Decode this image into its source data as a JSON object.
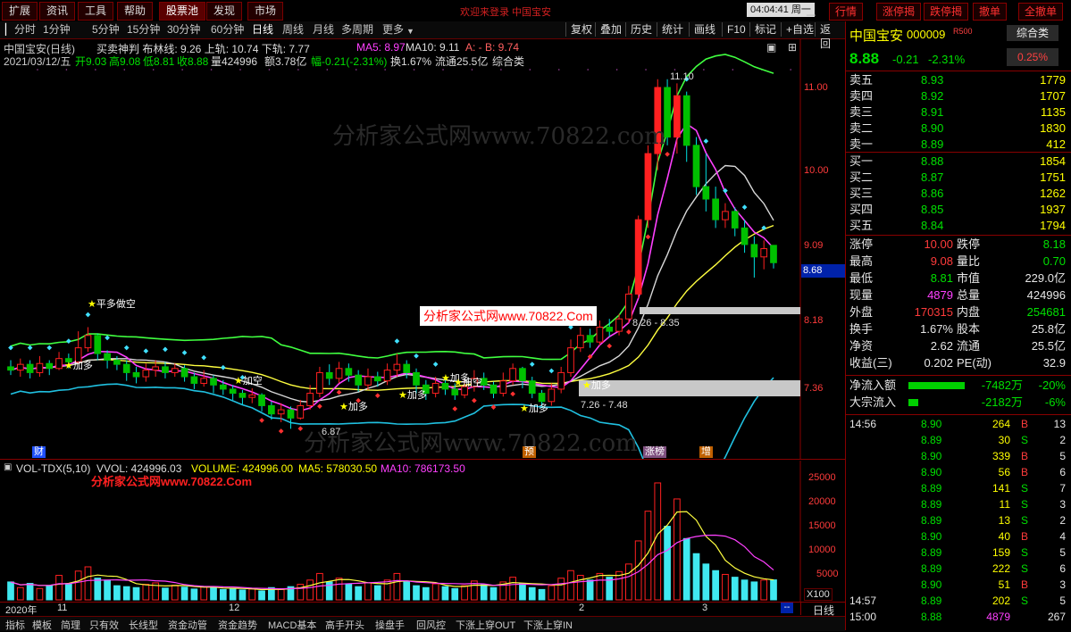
{
  "top_menu": [
    "扩展",
    "资讯",
    "工具",
    "帮助",
    "股票池",
    "发现",
    "市场"
  ],
  "top_center_text": "欢迎来登录  中国宝安",
  "clock": "04:04:41 周一",
  "right_buttons": [
    "行情",
    "涨停揭",
    "跌停揭",
    "撤单",
    "全撤单"
  ],
  "periods": [
    "分时",
    "1分钟",
    "5分钟",
    "15分钟",
    "30分钟",
    "60分钟",
    "日线",
    "周线",
    "月线",
    "多周期",
    "更多"
  ],
  "selected_period": "日线",
  "tools": [
    "复权",
    "叠加",
    "历史",
    "统计",
    "画线",
    "F10",
    "标记",
    "+自选",
    "返回"
  ],
  "info": {
    "line1_name": "中国宝安(日线)",
    "line1_rest": "买卖神判  布林线: 9.26  上轨: 10.74  下轨: 7.77",
    "ma5": "MA5: 8.97",
    "ma10": "MA10: 9.11",
    "ab": "A: -  B: 9.74",
    "line2_date": "2021/03/12/五",
    "line2_open": "开9.03",
    "line2_high": "高9.08",
    "line2_low": "低8.81",
    "line2_close": "收8.88",
    "line2_vol": "量424996",
    "line2_amt": "额3.78亿",
    "line2_chg": "幅-0.21(-2.31%)",
    "line2_turn": "换1.67%",
    "line2_float": "流通25.5亿",
    "line2_cat": "综合类"
  },
  "watermark": "分析家公式网www.70822.com",
  "watermark_box": "分析家公式网www.70822.Com",
  "watermark_vol": "分析家公式网www.70822.Com",
  "price_ticks": [
    "11.00",
    "10.00",
    "9.09",
    "8.18",
    "7.36"
  ],
  "current_price_tag": "8.68",
  "annotations": {
    "high_label": "11.10",
    "mid_label": "8.26 - 8.35",
    "low_label": "7.26 - 7.48",
    "low2": "6.87",
    "pingduo": "平多做空",
    "jiaduo": "加多",
    "jiakong": "加空",
    "flags": [
      "财",
      "预",
      "涨榜",
      "增"
    ]
  },
  "vol_header": {
    "name": "VOL-TDX(5,10)",
    "vvol": "VVOL: 424996.03",
    "volume": "VOLUME: 424996.00",
    "ma5": "MA5: 578030.50",
    "ma10": "MA10: 786173.50"
  },
  "vol_ticks": [
    "25000",
    "20000",
    "15000",
    "10000",
    "5000"
  ],
  "vol_unit": "X100",
  "date_axis": [
    "2020年",
    "11",
    "12",
    "2",
    "3"
  ],
  "bottom_tabs": [
    "指标",
    "模板",
    "简理",
    "只有效",
    "长线型",
    "资金动管",
    "资金趋势",
    "MACD基本",
    "高手开头",
    "操盘手",
    "回风控",
    "下涨上穿OUT",
    "下涨上穿IN"
  ],
  "bottom_right": "日线",
  "quote": {
    "name": "中国宝安",
    "code": "000009",
    "badge": "R500",
    "category": "综合类",
    "price": "8.88",
    "change": "-0.21",
    "pct": "-2.31%",
    "cat_pct": "0.25%",
    "asks": [
      {
        "label": "卖五",
        "price": "8.93",
        "vol": "1779"
      },
      {
        "label": "卖四",
        "price": "8.92",
        "vol": "1707"
      },
      {
        "label": "卖三",
        "price": "8.91",
        "vol": "1135"
      },
      {
        "label": "卖二",
        "price": "8.90",
        "vol": "1830"
      },
      {
        "label": "卖一",
        "price": "8.89",
        "vol": "412"
      }
    ],
    "bids": [
      {
        "label": "买一",
        "price": "8.88",
        "vol": "1854"
      },
      {
        "label": "买二",
        "price": "8.87",
        "vol": "1751"
      },
      {
        "label": "买三",
        "price": "8.86",
        "vol": "1262"
      },
      {
        "label": "买四",
        "price": "8.85",
        "vol": "1937"
      },
      {
        "label": "买五",
        "price": "8.84",
        "vol": "1794"
      }
    ],
    "stats": [
      {
        "l1": "涨停",
        "v1": "10.00",
        "l2": "跌停",
        "v2": "8.18"
      },
      {
        "l1": "最高",
        "v1": "9.08",
        "l2": "量比",
        "v2": "0.70"
      },
      {
        "l1": "最低",
        "v1": "8.81",
        "l2": "市值",
        "v2": "229.0亿"
      },
      {
        "l1": "现量",
        "v1": "4879",
        "l2": "总量",
        "v2": "424996"
      },
      {
        "l1": "外盘",
        "v1": "170315",
        "l2": "内盘",
        "v2": "254681"
      },
      {
        "l1": "换手",
        "v1": "1.67%",
        "l2": "股本",
        "v2": "25.8亿"
      },
      {
        "l1": "净资",
        "v1": "2.62",
        "l2": "流通",
        "v2": "25.5亿"
      },
      {
        "l1": "收益(三)",
        "v1": "0.202",
        "l2": "PE(动)",
        "v2": "32.9"
      }
    ],
    "flow": [
      {
        "label": "净流入额",
        "value": "-7482万",
        "pct": "-20%",
        "bar": 0.9
      },
      {
        "label": "大宗流入",
        "value": "-2182万",
        "pct": "-6%",
        "bar": 0.15
      }
    ],
    "ticks": [
      {
        "time": "14:56",
        "price": "8.90",
        "vol": "264",
        "bs": "B",
        "n": "13"
      },
      {
        "time": "",
        "price": "8.89",
        "vol": "30",
        "bs": "S",
        "n": "2"
      },
      {
        "time": "",
        "price": "8.90",
        "vol": "339",
        "bs": "B",
        "n": "5"
      },
      {
        "time": "",
        "price": "8.90",
        "vol": "56",
        "bs": "B",
        "n": "6"
      },
      {
        "time": "",
        "price": "8.89",
        "vol": "141",
        "bs": "S",
        "n": "7"
      },
      {
        "time": "",
        "price": "8.89",
        "vol": "11",
        "bs": "S",
        "n": "3"
      },
      {
        "time": "",
        "price": "8.89",
        "vol": "13",
        "bs": "S",
        "n": "2"
      },
      {
        "time": "",
        "price": "8.90",
        "vol": "40",
        "bs": "B",
        "n": "4"
      },
      {
        "time": "",
        "price": "8.89",
        "vol": "159",
        "bs": "S",
        "n": "5"
      },
      {
        "time": "",
        "price": "8.89",
        "vol": "222",
        "bs": "S",
        "n": "6"
      },
      {
        "time": "",
        "price": "8.90",
        "vol": "51",
        "bs": "B",
        "n": "3"
      },
      {
        "time": "14:57",
        "price": "8.89",
        "vol": "202",
        "bs": "S",
        "n": "5"
      },
      {
        "time": "15:00",
        "price": "8.88",
        "vol": "4879",
        "bs": "",
        "n": "267"
      }
    ]
  },
  "chart_data": {
    "type": "candlestick",
    "y_ticks": [
      7.36,
      8.18,
      9.09,
      10.0,
      11.0
    ],
    "candles": [
      [
        7.62,
        7.58,
        7.7,
        7.52
      ],
      [
        7.58,
        7.65,
        7.72,
        7.5
      ],
      [
        7.65,
        7.55,
        7.7,
        7.48
      ],
      [
        7.55,
        7.66,
        7.75,
        7.5
      ],
      [
        7.66,
        7.6,
        7.7,
        7.52
      ],
      [
        7.6,
        7.72,
        7.8,
        7.58
      ],
      [
        7.72,
        7.68,
        7.78,
        7.6
      ],
      [
        7.68,
        7.85,
        8.05,
        7.66
      ],
      [
        7.85,
        8.0,
        8.1,
        7.8
      ],
      [
        8.0,
        7.78,
        8.02,
        7.7
      ],
      [
        7.78,
        7.7,
        7.82,
        7.6
      ],
      [
        7.7,
        7.65,
        7.75,
        7.58
      ],
      [
        7.65,
        7.55,
        7.7,
        7.45
      ],
      [
        7.55,
        7.5,
        7.62,
        7.42
      ],
      [
        7.5,
        7.58,
        7.66,
        7.44
      ],
      [
        7.58,
        7.62,
        7.7,
        7.5
      ],
      [
        7.62,
        7.55,
        7.68,
        7.48
      ],
      [
        7.55,
        7.6,
        7.66,
        7.5
      ],
      [
        7.6,
        7.5,
        7.64,
        7.44
      ],
      [
        7.5,
        7.42,
        7.55,
        7.35
      ],
      [
        7.42,
        7.48,
        7.58,
        7.38
      ],
      [
        7.48,
        7.4,
        7.52,
        7.3
      ],
      [
        7.4,
        7.35,
        7.46,
        7.28
      ],
      [
        7.35,
        7.3,
        7.4,
        7.22
      ],
      [
        7.3,
        7.25,
        7.34,
        7.16
      ],
      [
        7.25,
        7.28,
        7.36,
        7.18
      ],
      [
        7.28,
        7.15,
        7.3,
        7.08
      ],
      [
        7.15,
        7.05,
        7.2,
        6.98
      ],
      [
        7.05,
        7.1,
        7.18,
        6.95
      ],
      [
        7.1,
        7.0,
        7.14,
        6.87
      ],
      [
        7.0,
        7.15,
        7.22,
        6.98
      ],
      [
        7.15,
        7.3,
        7.4,
        7.1
      ],
      [
        7.3,
        7.55,
        7.62,
        7.25
      ],
      [
        7.55,
        7.48,
        7.65,
        7.4
      ],
      [
        7.48,
        7.6,
        7.68,
        7.42
      ],
      [
        7.6,
        7.52,
        7.66,
        7.44
      ],
      [
        7.52,
        7.4,
        7.58,
        7.32
      ],
      [
        7.4,
        7.5,
        7.6,
        7.34
      ],
      [
        7.5,
        7.45,
        7.56,
        7.38
      ],
      [
        7.45,
        7.58,
        7.66,
        7.4
      ],
      [
        7.58,
        7.65,
        7.78,
        7.5
      ],
      [
        7.65,
        7.55,
        7.7,
        7.48
      ],
      [
        7.55,
        7.4,
        7.6,
        7.3
      ],
      [
        7.4,
        7.3,
        7.46,
        7.22
      ],
      [
        7.3,
        7.42,
        7.5,
        7.25
      ],
      [
        7.42,
        7.35,
        7.48,
        7.28
      ],
      [
        7.35,
        7.28,
        7.42,
        7.22
      ],
      [
        7.28,
        7.38,
        7.46,
        7.24
      ],
      [
        7.38,
        7.48,
        7.58,
        7.32
      ],
      [
        7.48,
        7.4,
        7.55,
        7.34
      ],
      [
        7.4,
        7.3,
        7.44,
        7.24
      ],
      [
        7.3,
        7.45,
        7.55,
        7.26
      ],
      [
        7.45,
        7.6,
        7.66,
        7.4
      ],
      [
        7.6,
        7.45,
        7.62,
        7.36
      ],
      [
        7.45,
        7.3,
        7.5,
        7.24
      ],
      [
        7.3,
        7.2,
        7.34,
        7.12
      ],
      [
        7.2,
        7.35,
        7.42,
        7.15
      ],
      [
        7.35,
        7.55,
        7.62,
        7.3
      ],
      [
        7.55,
        7.85,
        7.95,
        7.5
      ],
      [
        7.85,
        8.0,
        8.1,
        7.8
      ],
      [
        8.0,
        7.92,
        8.08,
        7.85
      ],
      [
        7.92,
        8.1,
        8.18,
        7.88
      ],
      [
        8.1,
        8.05,
        8.2,
        7.98
      ],
      [
        8.05,
        8.2,
        8.26,
        8.0
      ],
      [
        8.2,
        8.5,
        8.6,
        8.15
      ],
      [
        8.5,
        9.4,
        9.45,
        8.45
      ],
      [
        9.4,
        10.2,
        10.3,
        9.3
      ],
      [
        10.2,
        11.0,
        11.1,
        10.0
      ],
      [
        11.0,
        10.4,
        11.1,
        10.3
      ],
      [
        10.4,
        10.9,
        11.05,
        10.2
      ],
      [
        10.9,
        10.3,
        10.95,
        10.1
      ],
      [
        10.3,
        9.8,
        10.4,
        9.7
      ],
      [
        9.8,
        9.65,
        10.2,
        9.5
      ],
      [
        9.65,
        9.4,
        9.8,
        9.3
      ],
      [
        9.4,
        9.5,
        9.6,
        9.3
      ],
      [
        9.5,
        9.3,
        9.55,
        9.2
      ],
      [
        9.3,
        9.1,
        9.4,
        9.0
      ],
      [
        9.1,
        8.95,
        9.2,
        8.7
      ],
      [
        8.95,
        9.05,
        9.15,
        8.8
      ],
      [
        9.09,
        8.88,
        9.08,
        8.81
      ]
    ],
    "volume": [
      380,
      260,
      350,
      240,
      300,
      520,
      340,
      610,
      700,
      460,
      420,
      300,
      280,
      260,
      330,
      360,
      250,
      310,
      270,
      230,
      280,
      260,
      220,
      240,
      210,
      230,
      190,
      260,
      220,
      280,
      330,
      420,
      560,
      380,
      460,
      340,
      280,
      360,
      300,
      420,
      560,
      380,
      300,
      260,
      340,
      280,
      240,
      300,
      400,
      320,
      260,
      380,
      480,
      340,
      260,
      220,
      300,
      460,
      620,
      520,
      420,
      560,
      480,
      600,
      760,
      1250,
      1880,
      2480,
      1560,
      2140,
      1300,
      980,
      760,
      620,
      540,
      480,
      420,
      380,
      420,
      424
    ]
  }
}
